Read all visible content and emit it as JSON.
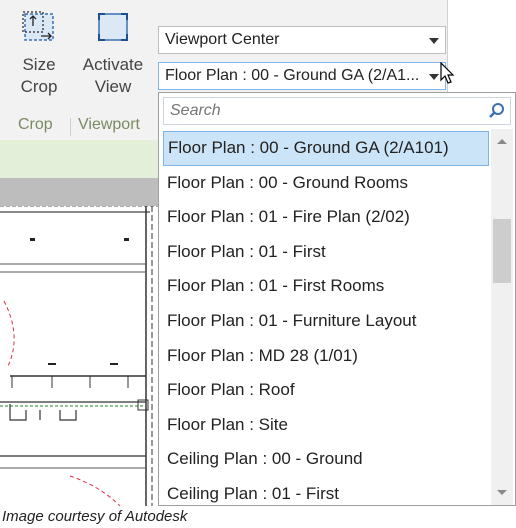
{
  "ribbon": {
    "crop_panel": {
      "size_crop_label_line1": "Size",
      "size_crop_label_line2": "Crop",
      "panel_label": "Crop"
    },
    "viewport_panel": {
      "activate_view_label_line1": "Activate",
      "activate_view_label_line2": "View",
      "panel_label": "Viewport"
    }
  },
  "viewport_position": {
    "selected": "Viewport Center"
  },
  "view_selector": {
    "selected_truncated": "Floor Plan : 00 - Ground GA (2/A1..."
  },
  "dropdown": {
    "search_placeholder": "Search",
    "items": [
      "Floor Plan : 00 - Ground GA (2/A101)",
      "Floor Plan : 00 - Ground Rooms",
      "Floor Plan : 01 - Fire Plan (2/02)",
      "Floor Plan : 01 - First",
      "Floor Plan : 01 - First Rooms",
      "Floor Plan : 01 - Furniture Layout",
      "Floor Plan : MD 28 (1/01)",
      "Floor Plan : Roof",
      "Floor Plan : Site",
      "Ceiling Plan : 00 - Ground",
      "Ceiling Plan : 01 - First"
    ],
    "selected_index": 0
  },
  "caption": "Image courtesy of Autodesk",
  "colors": {
    "ribbon_bg": "#f2f2f2",
    "panel_label": "#7a8a63",
    "selection_bg": "#cce4f7",
    "selection_border": "#7eb4ea"
  }
}
